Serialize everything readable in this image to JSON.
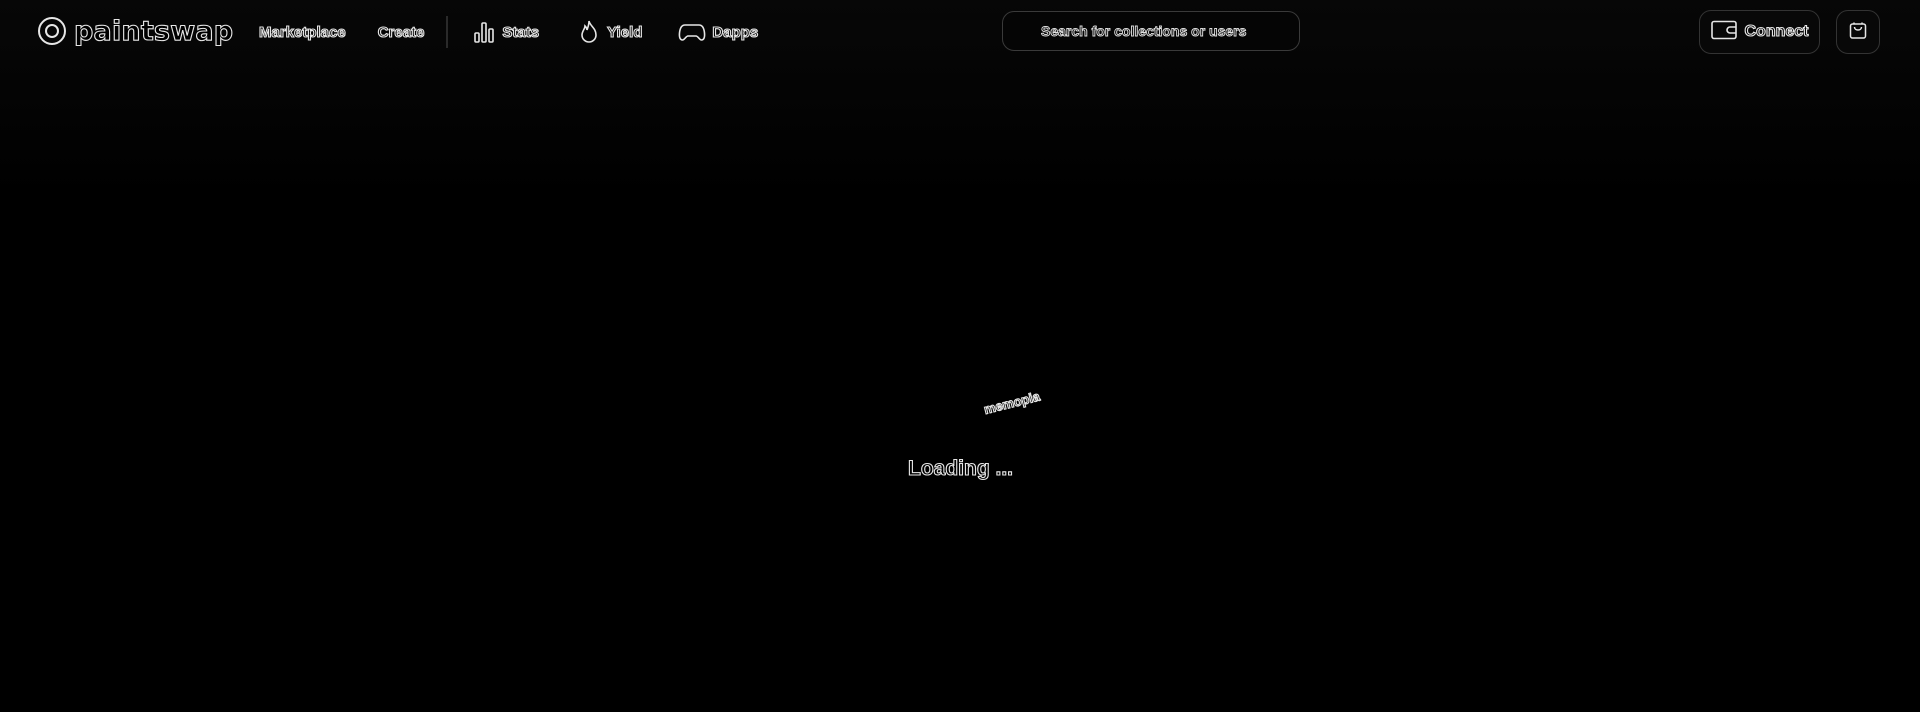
{
  "brand": {
    "name": "paintswap",
    "icon": "paintswap-logo-icon"
  },
  "nav": {
    "marketplace": "Marketplace",
    "create": "Create",
    "stats": "Stats",
    "yield": "Yield",
    "dapps": "Dapps",
    "icons": {
      "stats": "bar-chart-icon",
      "yield": "flame-icon",
      "dapps": "gamepad-icon"
    }
  },
  "search": {
    "placeholder": "Search for collections or users"
  },
  "wallet": {
    "connect_label": "Connect",
    "icon": "wallet-icon"
  },
  "cart": {
    "icon": "shopping-bag-icon"
  },
  "loading": {
    "tag": "memopia",
    "text": "Loading ..."
  },
  "colors": {
    "background": "#000000",
    "text_outline": "#e6e6e6",
    "border": "#333333"
  }
}
